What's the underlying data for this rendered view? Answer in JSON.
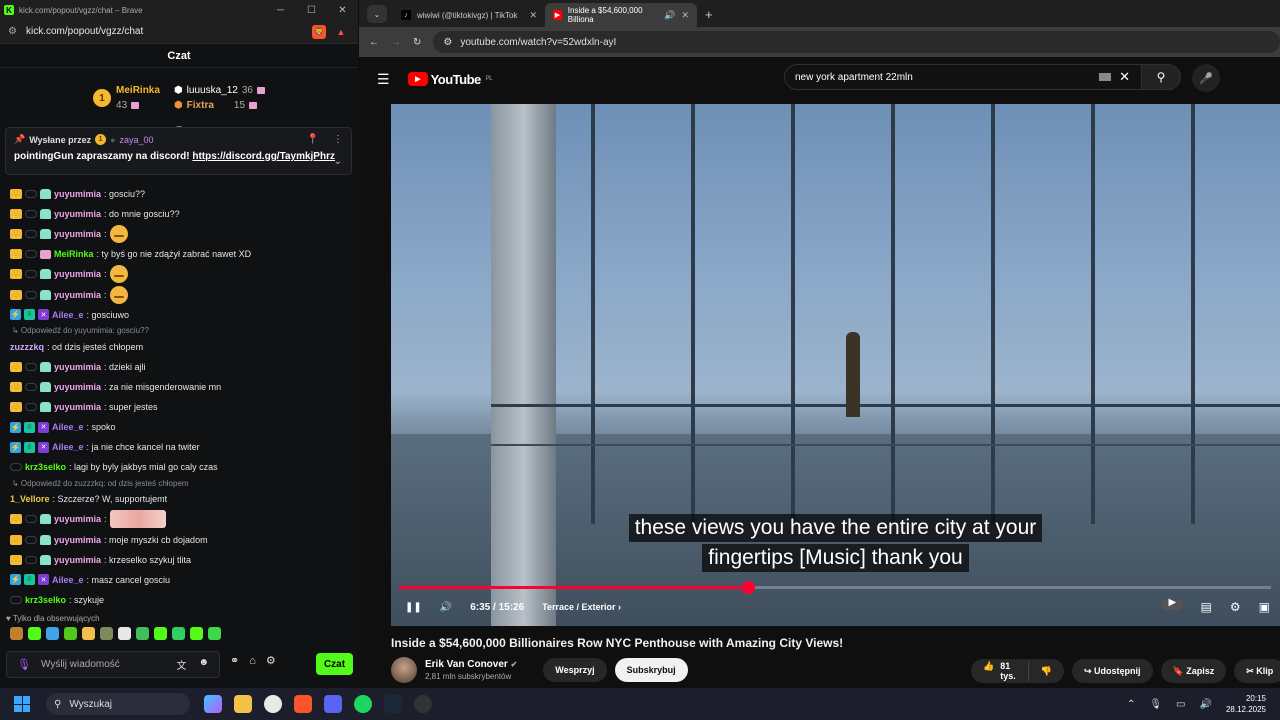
{
  "left_window": {
    "title": "kick.com/popout/vgzz/chat – Brave",
    "url": "kick.com/popout/vgzz/chat",
    "brave_badge": "4",
    "chat_header": "Czat",
    "leaders": {
      "first": {
        "rank": "1",
        "name": "MeiRinka",
        "count": "43"
      },
      "second": {
        "name": "luuuska_12",
        "count": "36"
      },
      "third": {
        "name": "Fixtra",
        "count": "15"
      }
    },
    "pinned": {
      "label": "Wysłane przez",
      "sender": "zaya_00",
      "text": "pointingGun zapraszamy na discord! ",
      "link": "https://discord.gg/TaymkjPhrz"
    },
    "messages": [
      {
        "type": "msg",
        "user": "yuyumimia",
        "cls": "u-yuyu",
        "badges": [
          "crown",
          "cloud",
          "ghost"
        ],
        "text": ": gosciu??"
      },
      {
        "type": "msg",
        "user": "yuyumimia",
        "cls": "u-yuyu",
        "badges": [
          "crown",
          "cloud",
          "ghost"
        ],
        "text": ": do mnie gosciu??"
      },
      {
        "type": "msg",
        "user": "yuyumimia",
        "cls": "u-yuyu",
        "badges": [
          "crown",
          "cloud",
          "ghost"
        ],
        "text": ":",
        "emoji": "face"
      },
      {
        "type": "msg",
        "user": "MeiRinka",
        "cls": "u-mei",
        "badges": [
          "crown",
          "cloud",
          "pink"
        ],
        "text": ": ty byś go nie zdążył zabrać nawet XD"
      },
      {
        "type": "msg",
        "user": "yuyumimia",
        "cls": "u-yuyu",
        "badges": [
          "crown",
          "cloud",
          "ghost"
        ],
        "text": ":",
        "emoji": "face"
      },
      {
        "type": "msg",
        "user": "yuyumimia",
        "cls": "u-yuyu",
        "badges": [
          "crown",
          "cloud",
          "ghost"
        ],
        "text": ":",
        "emoji": "face"
      },
      {
        "type": "msg",
        "user": "Ailee_e",
        "cls": "u-ailee",
        "badges": [
          "bolt",
          "teal",
          "purple"
        ],
        "text": ": gosciuwo"
      },
      {
        "type": "reply",
        "text": "↳ Odpowiedź do yuyumimia: gosciu??"
      },
      {
        "type": "msg",
        "user": "zuzzzkq",
        "cls": "u-zuzz",
        "badges": [],
        "text": ": od dzis jesteś chłopem"
      },
      {
        "type": "msg",
        "user": "yuyumimia",
        "cls": "u-yuyu",
        "badges": [
          "crown",
          "cloud",
          "ghost"
        ],
        "text": ": dzieki ajli"
      },
      {
        "type": "msg",
        "user": "yuyumimia",
        "cls": "u-yuyu",
        "badges": [
          "crown",
          "cloud",
          "ghost"
        ],
        "text": ": za nie misgenderowanie mn"
      },
      {
        "type": "msg",
        "user": "yuyumimia",
        "cls": "u-yuyu",
        "badges": [
          "crown",
          "cloud",
          "ghost"
        ],
        "text": ": super jestes"
      },
      {
        "type": "msg",
        "user": "Ailee_e",
        "cls": "u-ailee",
        "badges": [
          "bolt",
          "teal",
          "purple"
        ],
        "text": ": spoko"
      },
      {
        "type": "msg",
        "user": "Ailee_e",
        "cls": "u-ailee",
        "badges": [
          "bolt",
          "teal",
          "purple"
        ],
        "text": ": ja nie chce kancel na twiter"
      },
      {
        "type": "msg",
        "user": "krz3selko",
        "cls": "u-krz",
        "badges": [
          "cloud"
        ],
        "text": ": lagi by byly jakbys mial go caly czas"
      },
      {
        "type": "reply",
        "text": "↳ Odpowiedź do zuzzzkq: od dzis jesteś chłopem"
      },
      {
        "type": "msg",
        "user": "1_Vellore",
        "cls": "u-vel",
        "badges": [],
        "text": ": Szczerze? W, supportujemt"
      },
      {
        "type": "msg",
        "user": "yuyumimia",
        "cls": "u-yuyu",
        "badges": [
          "crown",
          "cloud",
          "ghost"
        ],
        "text": ":",
        "emoji": "image"
      },
      {
        "type": "msg",
        "user": "yuyumimia",
        "cls": "u-yuyu",
        "badges": [
          "crown",
          "cloud",
          "ghost"
        ],
        "text": ": moje myszki cb dojadom"
      },
      {
        "type": "msg",
        "user": "yuyumimia",
        "cls": "u-yuyu",
        "badges": [
          "crown",
          "cloud",
          "ghost"
        ],
        "text": ": krzeselko szykuj tlita"
      },
      {
        "type": "msg",
        "user": "Ailee_e",
        "cls": "u-ailee",
        "badges": [
          "bolt",
          "teal",
          "purple"
        ],
        "text": ": masz cancel gosciu"
      },
      {
        "type": "msg",
        "user": "krz3selko",
        "cls": "u-krz",
        "badges": [
          "cloud"
        ],
        "text": ": szykuje"
      }
    ],
    "follow_only": "Tylko dla obserwujących",
    "input_placeholder": "Wyślij wiadomość",
    "send_label": "Czat"
  },
  "right_window": {
    "tabs": [
      {
        "label": "wiwiwi (@tiktokivgz) | TikTok",
        "icon": "tiktok-icon",
        "active": false
      },
      {
        "label": "Inside a $54,600,000 Billiona",
        "icon": "youtube-icon",
        "active": true
      }
    ],
    "url": "youtube.com/watch?v=52wdxln-ayI",
    "logo": "YouTube",
    "logo_region": "PL",
    "search_query": "new york apartment 22mln",
    "captions": [
      "these views you have the entire city at your",
      "fingertips [Music] thank you"
    ],
    "progress": 0.4,
    "time": "6:35 / 15:26",
    "chapter": "Terrace / Exterior",
    "video_title": "Inside a $54,600,000 Billionaires Row NYC Penthouse with Amazing City Views!",
    "channel_name": "Erik Van Conover",
    "channel_subs": "2,81 mln subskrybentów",
    "support_label": "Wesprzyj",
    "subscribe_label": "Subskrybuj",
    "likes": "81 tys.",
    "share_label": "Udostępnij",
    "save_label": "Zapisz",
    "clip_label": "Klip"
  },
  "taskbar": {
    "search_placeholder": "Wyszukaj",
    "time": "20:15",
    "date": "28.12.2025"
  }
}
